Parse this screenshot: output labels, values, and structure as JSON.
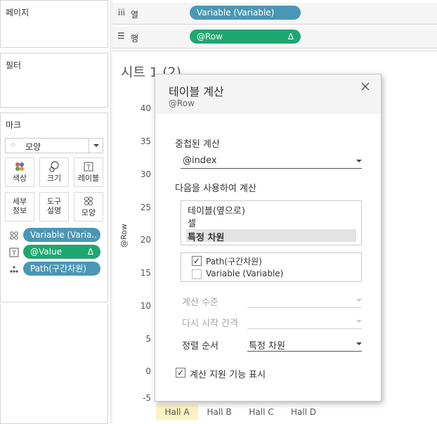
{
  "pages": {
    "label": "페이지"
  },
  "filters": {
    "label": "필터"
  },
  "marks": {
    "label": "마크",
    "mark_type": "모양",
    "buttons": [
      {
        "label": "색상",
        "icon": "color-icon"
      },
      {
        "label": "크기",
        "icon": "size-icon"
      },
      {
        "label": "레이블",
        "icon": "label-icon"
      },
      {
        "label_line1": "세부",
        "label_line2": "정보",
        "icon": "detail-icon"
      },
      {
        "label_line1": "도구",
        "label_line2": "설명",
        "icon": "tooltip-icon"
      },
      {
        "label": "모양",
        "icon": "shape-icon"
      }
    ],
    "fields": [
      {
        "label": "Variable (Varia..",
        "color": "#4a97b5",
        "icon": "shape-icon"
      },
      {
        "label": "@Value",
        "delta": "Δ",
        "color": "#1fa771",
        "icon": "text-icon"
      },
      {
        "label": "Path(구간차원)",
        "color": "#4a97b5",
        "icon": "detail-icon"
      }
    ]
  },
  "columns_shelf": {
    "label": "열",
    "pill": "Variable (Variable)"
  },
  "rows_shelf": {
    "label": "행",
    "pill": "@Row",
    "delta": "Δ"
  },
  "sheet": {
    "title": "시트 1 (2)",
    "y_axis_label": "@Row",
    "y_ticks": [
      "40",
      "35",
      "30",
      "25",
      "20",
      "15",
      "10",
      "5",
      "0",
      "-5"
    ],
    "x_ticks": [
      "Hall A",
      "Hall B",
      "Hall C",
      "Hall D"
    ]
  },
  "dialog": {
    "title": "테이블 계산",
    "subtitle": "@Row",
    "nested_label": "중첩된 계산",
    "nested_value": "@index",
    "compute_using_label": "다음을 사용하여 계산",
    "compute_options": [
      "테이블(옆으로)",
      "셀",
      "특정 차원"
    ],
    "dimensions": [
      {
        "label": "Path(구간차원)",
        "checked": "✓"
      },
      {
        "label": "Variable (Variable)",
        "checked": ""
      }
    ],
    "level_label": "계산 수준",
    "restart_label": "다시 시작 간격",
    "sort_label": "정렬 순서",
    "sort_value": "특정 차원",
    "show_assist_label": "계산 지원 기능 표시",
    "show_assist_checked": "✓",
    "close_icon": "close-icon"
  }
}
